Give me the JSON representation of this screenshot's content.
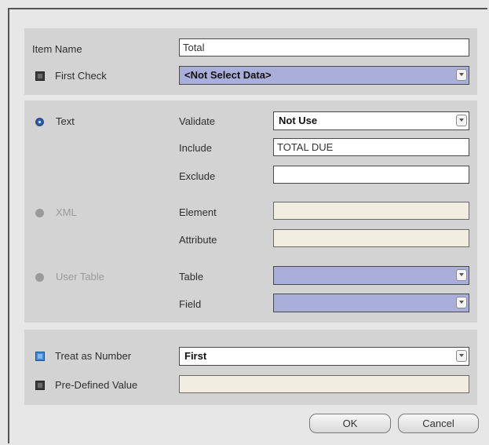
{
  "item": {
    "name_label": "Item Name",
    "name_value": "Total",
    "first_check_label": "First Check",
    "first_check_value": "<Not Select Data>"
  },
  "text_section": {
    "label": "Text",
    "validate_label": "Validate",
    "validate_value": "Not Use",
    "include_label": "Include",
    "include_value": "TOTAL DUE",
    "exclude_label": "Exclude",
    "exclude_value": ""
  },
  "xml_section": {
    "label": "XML",
    "element_label": "Element",
    "element_value": "",
    "attribute_label": "Attribute",
    "attribute_value": ""
  },
  "user_table_section": {
    "label": "User Table",
    "table_label": "Table",
    "table_value": "",
    "field_label": "Field",
    "field_value": ""
  },
  "number": {
    "treat_label": "Treat as Number",
    "treat_value": "First",
    "predefined_label": "Pre-Defined Value",
    "predefined_value": ""
  },
  "buttons": {
    "ok": "OK",
    "cancel": "Cancel"
  },
  "colors": {
    "panel": "#d3d3d3",
    "select_purple": "#a9afd8",
    "readonly_beige": "#f1ede0",
    "radio_selected": "#2a63b8"
  }
}
